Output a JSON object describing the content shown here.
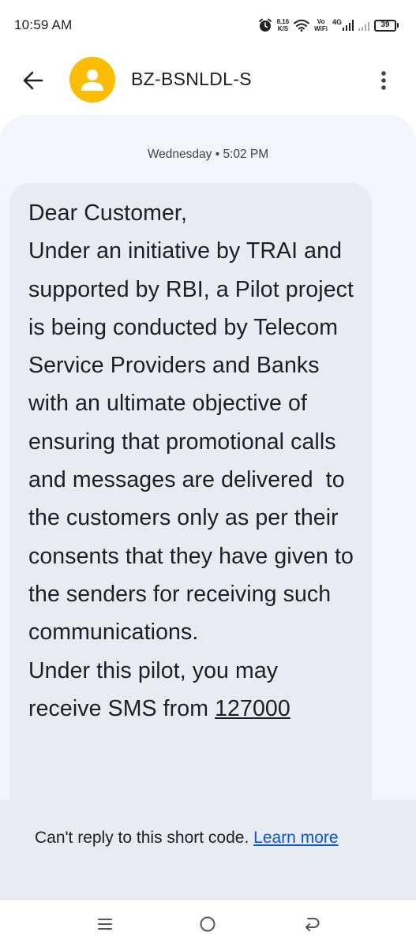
{
  "status_bar": {
    "time": "10:59 AM",
    "speed_value": "8.16",
    "speed_unit": "K/S",
    "vo_label": "Vo",
    "wifi_label": "WiFi",
    "network_label": "4G",
    "battery_level": "39"
  },
  "header": {
    "contact_name": "BZ-BSNLDL-S",
    "avatar_color": "#fbbc04"
  },
  "conversation": {
    "timestamp": "Wednesday • 5:02 PM",
    "message_text": "Dear Customer,\nUnder an initiative by TRAI and supported by RBI, a Pilot project is being conducted by Telecom Service Providers and Banks with an ultimate objective of ensuring that promotional calls and messages are delivered  to the customers only as per their consents that they have given to the senders for receiving such communications.\nUnder this pilot, you may receive SMS from ",
    "message_link": "127000"
  },
  "notice": {
    "text": "Can't reply to this short code. ",
    "link": "Learn more"
  },
  "nav": {
    "icons": [
      "menu-icon",
      "home-icon",
      "back-icon"
    ]
  }
}
